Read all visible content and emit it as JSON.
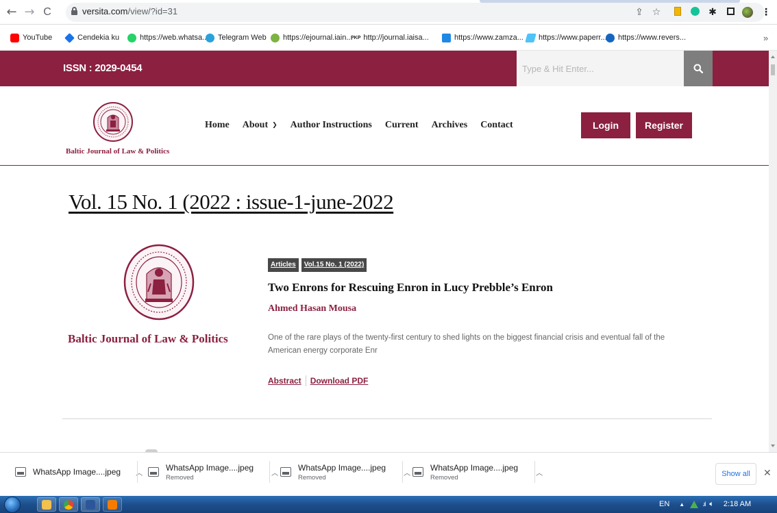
{
  "browser": {
    "url_host": "versita.com",
    "url_path": "/view/?id=31",
    "nav": {
      "back": "←",
      "forward": "→",
      "reload": "C"
    }
  },
  "bookmarks": [
    {
      "label": "YouTube",
      "color": "#ff0000"
    },
    {
      "label": "Cendekia ku",
      "color": "#1a73e8"
    },
    {
      "label": "https://web.whatsa...",
      "color": "#25d366"
    },
    {
      "label": "Telegram Web",
      "color": "#2aa1da"
    },
    {
      "label": "https://ejournal.iain...",
      "color": "#7cb342"
    },
    {
      "label": "http://journal.iaisa...",
      "color": "#222222",
      "prefix": "PKP"
    },
    {
      "label": "https://www.zamza...",
      "color": "#1e88e5"
    },
    {
      "label": "https://www.paperr...",
      "color": "#4fc3f7"
    },
    {
      "label": "https://www.revers...",
      "color": "#1565c0"
    }
  ],
  "bookmarks_overflow": "»",
  "site": {
    "issn": "ISSN : 2029-0454",
    "search_placeholder": "Type & Hit Enter...",
    "logo_text": "Baltic Journal of Law & Politics",
    "nav": {
      "home": "Home",
      "about": "About",
      "author_instructions": "Author Instructions",
      "current": "Current",
      "archives": "Archives",
      "contact": "Contact"
    },
    "login": "Login",
    "register": "Register",
    "colors": {
      "brand": "#8b2040",
      "search_button": "#7e7e7e"
    }
  },
  "issue": {
    "title": "Vol. 15 No. 1 (2022 : issue-1-june-2022",
    "thumbnail_text": "Baltic Journal of Law & Politics"
  },
  "article": {
    "tags": [
      "Articles",
      "Vol.15 No. 1 (2022)"
    ],
    "title": "Two Enrons for Rescuing Enron in Lucy Prebble’s Enron",
    "author": "Ahmed Hasan Mousa",
    "abstract": "One of the rare plays of the twenty-first century to shed lights on the biggest financial crisis and eventual fall of the American energy corporate Enr",
    "abstract_link": "Abstract",
    "pdf_link": "Download PDF"
  },
  "downloads": [
    {
      "name": "WhatsApp Image....jpeg",
      "status": ""
    },
    {
      "name": "WhatsApp Image....jpeg",
      "status": "Removed"
    },
    {
      "name": "WhatsApp Image....jpeg",
      "status": "Removed"
    },
    {
      "name": "WhatsApp Image....jpeg",
      "status": "Removed"
    }
  ],
  "downloads_show_all": "Show all",
  "downloads_close": "✕",
  "taskbar": {
    "lang": "EN",
    "time": "2:18 AM"
  }
}
